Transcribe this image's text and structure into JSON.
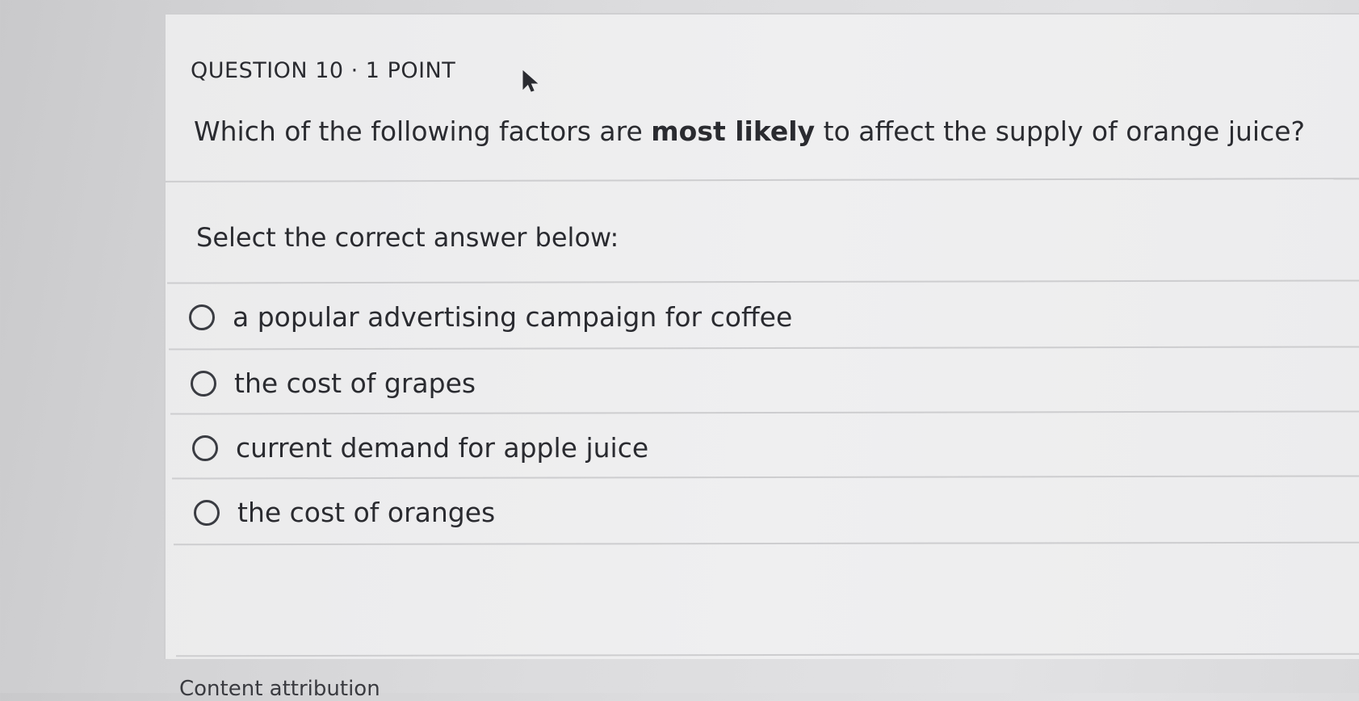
{
  "question": {
    "header": "QUESTION 10 · 1 POINT",
    "text_before": "Which of the following factors are ",
    "text_bold": "most likely",
    "text_after": " to affect the supply of orange juice?"
  },
  "instruction": "Select the correct answer below:",
  "options": [
    {
      "label": "a popular advertising campaign for coffee",
      "selected": false
    },
    {
      "label": "the cost of grapes",
      "selected": false
    },
    {
      "label": "current demand for apple juice",
      "selected": false
    },
    {
      "label": "the cost of oranges",
      "selected": false
    }
  ],
  "footer": {
    "attribution": "Content attribution"
  },
  "icons": {
    "cursor": "arrow-cursor-icon",
    "radio": "radio-unselected-icon"
  },
  "colors": {
    "text": "#2a2b30",
    "divider": "#cdcdcf",
    "radio_border": "#3a3c42"
  }
}
